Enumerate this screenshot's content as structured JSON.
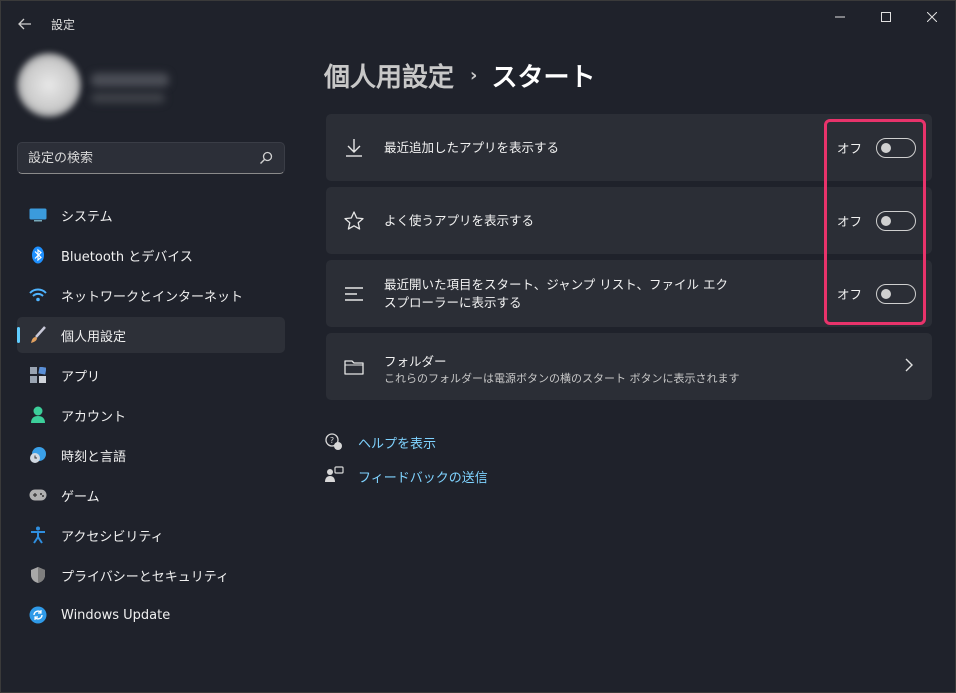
{
  "window": {
    "title": "設定",
    "controls": {
      "minimize": "—",
      "maximize": "☐",
      "close": "✕"
    }
  },
  "search": {
    "placeholder": "設定の検索"
  },
  "sidebar": {
    "items": [
      {
        "label": "システム",
        "icon": "system-icon",
        "color": "#3b9bdc"
      },
      {
        "label": "Bluetooth とデバイス",
        "icon": "bluetooth-icon",
        "color": "#1e90ff"
      },
      {
        "label": "ネットワークとインターネット",
        "icon": "network-icon",
        "color": "#4fb4ff"
      },
      {
        "label": "個人用設定",
        "icon": "personalization-brush-icon",
        "color": "#e0a060",
        "active": true
      },
      {
        "label": "アプリ",
        "icon": "apps-icon",
        "color": "#9aa4b2"
      },
      {
        "label": "アカウント",
        "icon": "account-icon",
        "color": "#3ccf9a"
      },
      {
        "label": "時刻と言語",
        "icon": "time-language-icon",
        "color": "#3aa0e8"
      },
      {
        "label": "ゲーム",
        "icon": "gaming-icon",
        "color": "#b0b0b0"
      },
      {
        "label": "アクセシビリティ",
        "icon": "accessibility-icon",
        "color": "#2f8fe0"
      },
      {
        "label": "プライバシーとセキュリティ",
        "icon": "shield-icon",
        "color": "#a8a8a8"
      },
      {
        "label": "Windows Update",
        "icon": "windows-update-icon",
        "color": "#2f9ae8"
      }
    ]
  },
  "breadcrumb": {
    "parent": "個人用設定",
    "separator": "›",
    "current": "スタート"
  },
  "settings": [
    {
      "label": "最近追加したアプリを表示する",
      "state": "オフ",
      "icon": "download-icon"
    },
    {
      "label": "よく使うアプリを表示する",
      "state": "オフ",
      "icon": "star-icon"
    },
    {
      "label": "最近開いた項目をスタート、ジャンプ リスト、ファイル エクスプローラーに表示する",
      "state": "オフ",
      "icon": "list-icon"
    }
  ],
  "folders": {
    "title": "フォルダー",
    "subtitle": "これらのフォルダーは電源ボタンの横のスタート ボタンに表示されます",
    "icon": "folder-icon"
  },
  "links": {
    "help": "ヘルプを表示",
    "feedback": "フィードバックの送信"
  },
  "colors": {
    "accent": "#60cdff",
    "highlight": "#e8336b",
    "background": "#1f222b",
    "card": "#2b2e36"
  }
}
